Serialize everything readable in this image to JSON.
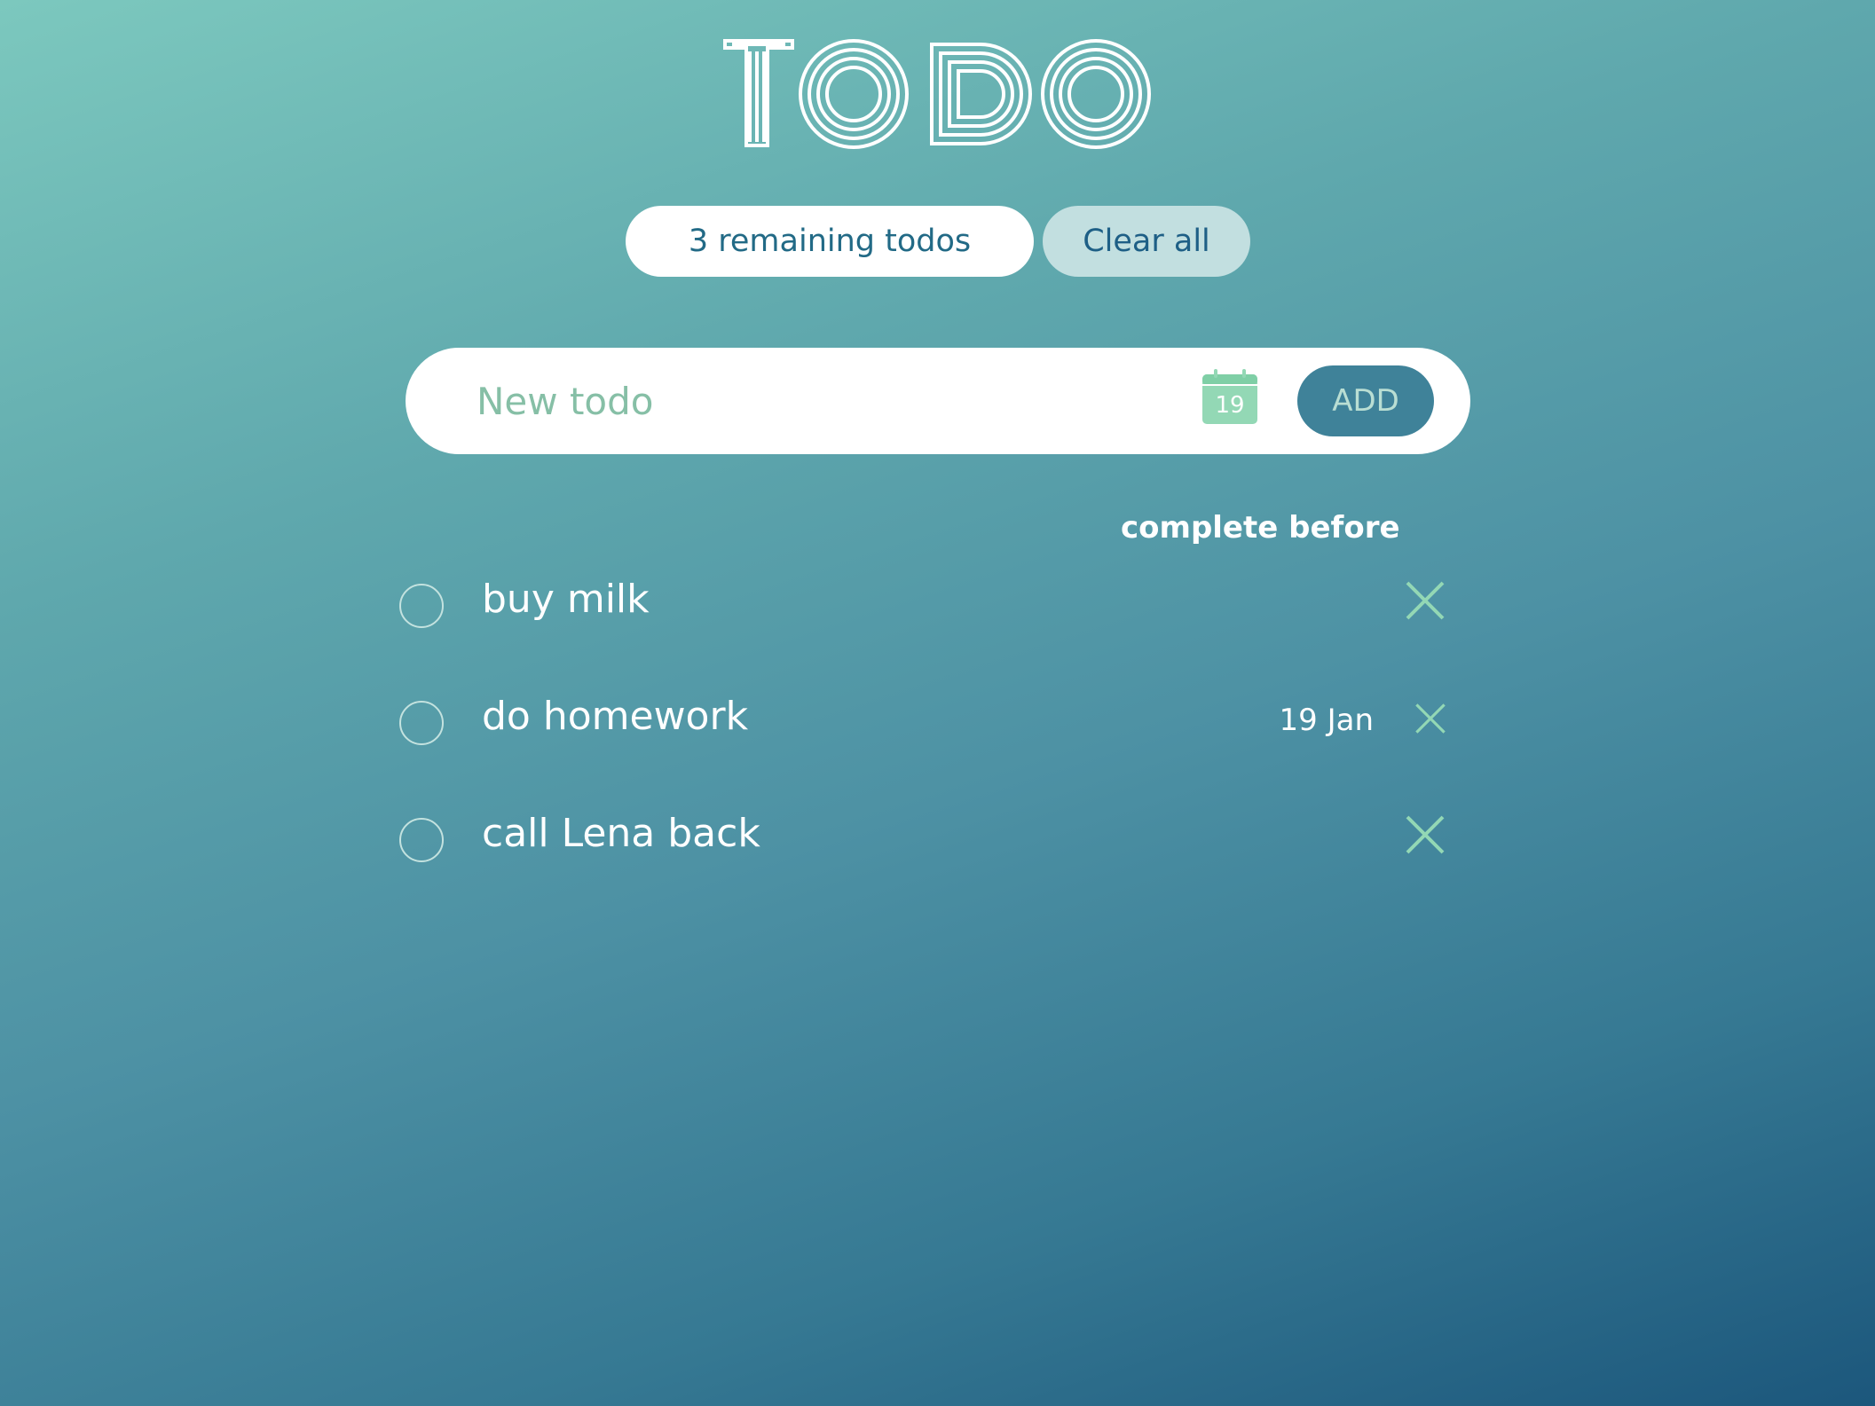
{
  "app": {
    "logo_text": "TODO"
  },
  "summary": {
    "remaining_label": "3 remaining todos",
    "clear_label": "Clear all"
  },
  "new_todo": {
    "placeholder": "New todo",
    "value": "",
    "calendar_icon": "calendar-icon",
    "calendar_day": "19",
    "add_label": "ADD"
  },
  "list": {
    "column_header": "complete before",
    "items": [
      {
        "text": "buy milk",
        "date": "",
        "completed": false,
        "delete_icon": "close-icon"
      },
      {
        "text": "do homework",
        "date": "19 Jan",
        "completed": false,
        "delete_icon": "close-icon"
      },
      {
        "text": "call Lena back",
        "date": "",
        "completed": false,
        "delete_icon": "close-icon"
      }
    ]
  },
  "colors": {
    "accent_green": "#93d8b5",
    "pill_text": "#226a86",
    "add_button": "#3f8299",
    "background_top": "#7cc8be",
    "background_bottom": "#1c577c"
  }
}
